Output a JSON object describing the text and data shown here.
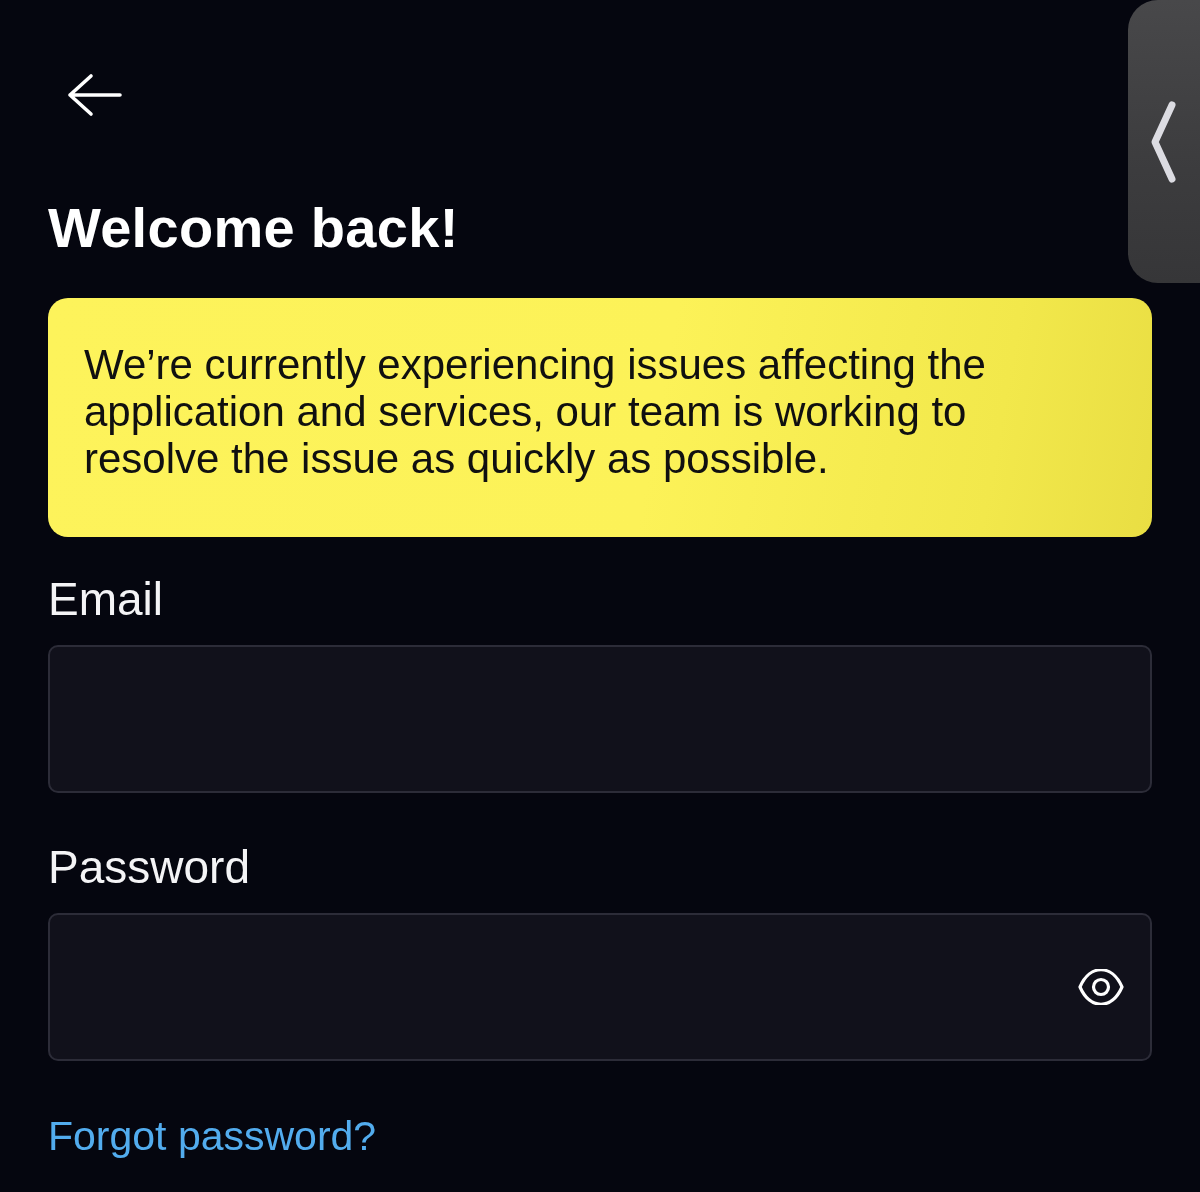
{
  "header": {
    "title": "Welcome back!"
  },
  "notice": {
    "text": "We’re currently experiencing issues affecting the application and services, our team is working to resolve the issue as quickly as possible."
  },
  "fields": [
    {
      "kind": "email",
      "label": "Email"
    },
    {
      "kind": "password",
      "label": "Password"
    }
  ],
  "forgot_password_link": "Forgot password?"
}
